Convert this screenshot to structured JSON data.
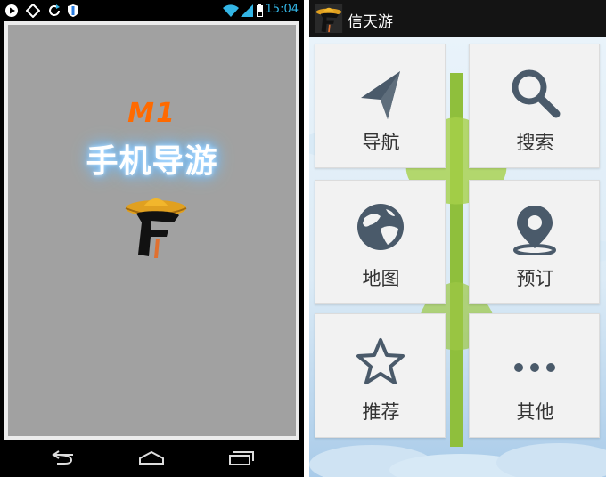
{
  "status_bar": {
    "time": "15:04",
    "left_icons": [
      "play-icon",
      "diamond-icon",
      "refresh-icon",
      "shield-icon"
    ],
    "right_icons": [
      "wifi-icon",
      "signal-icon",
      "battery-icon"
    ]
  },
  "splash": {
    "badge": "M1",
    "title": "手机导游",
    "logo": "sombrero-f-logo",
    "background": "#a1a1a1"
  },
  "nav_bar": {
    "buttons": [
      "back-icon",
      "home-icon",
      "recent-apps-icon"
    ]
  },
  "app": {
    "title": "信天游",
    "icon": "sombrero-f-logo",
    "accent": "#4a5a6a",
    "tiles": [
      {
        "label": "导航",
        "icon": "navigation-arrow-icon"
      },
      {
        "label": "搜索",
        "icon": "search-icon"
      },
      {
        "label": "地图",
        "icon": "globe-icon"
      },
      {
        "label": "预订",
        "icon": "location-pin-icon"
      },
      {
        "label": "推荐",
        "icon": "star-icon"
      },
      {
        "label": "其他",
        "icon": "more-dots-icon"
      }
    ]
  }
}
